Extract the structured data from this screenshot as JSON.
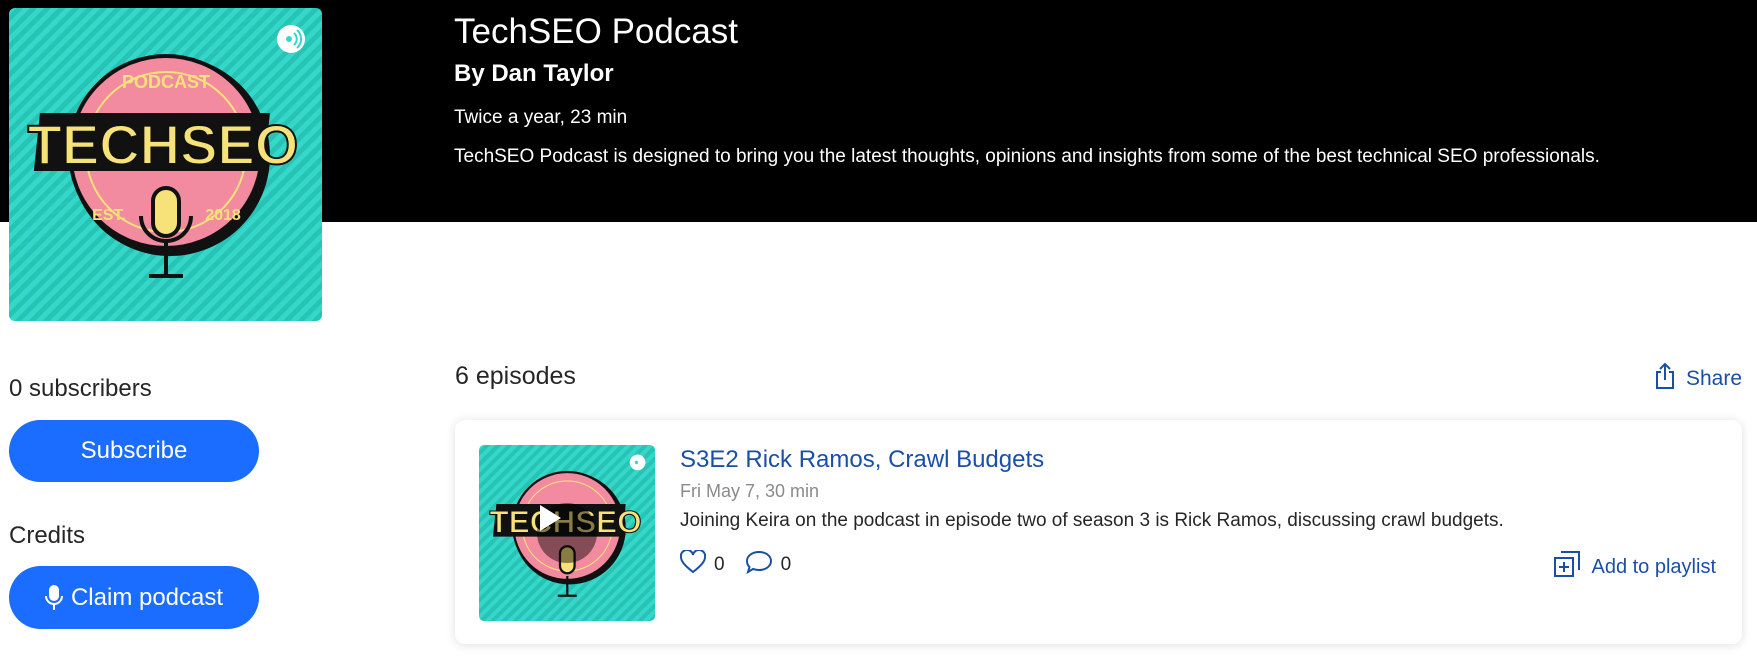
{
  "podcast": {
    "title": "TechSEO Podcast",
    "author": "By Dan Taylor",
    "frequency": "Twice a year, 23 min",
    "description": "TechSEO Podcast is designed to bring you the latest thoughts, opinions and insights from some of the best technical SEO professionals.",
    "cover_icon": "techseo-podcast-logo"
  },
  "cover_art": {
    "top_text": "PODCAST",
    "main_text": "TECHSEO",
    "bottom_left": "EST.",
    "bottom_right": "2018"
  },
  "sidebar": {
    "subscribers_label": "0 subscribers",
    "subscribe_label": "Subscribe",
    "credits_label": "Credits",
    "claim_label": "Claim podcast"
  },
  "episodes": {
    "count_label": "6 episodes",
    "share_label": "Share",
    "items": [
      {
        "title": "S3E2 Rick Ramos, Crawl Budgets",
        "meta": "Fri May 7, 30 min",
        "description": "Joining Keira on the podcast in episode two of season 3 is Rick Ramos, discussing crawl budgets.",
        "likes": "0",
        "comments": "0",
        "playlist_label": "Add to playlist"
      }
    ]
  },
  "colors": {
    "hero_bg": "#000000",
    "accent_blue": "#1a6dff",
    "link_blue": "#1a4fa8",
    "cover_teal": "#35d8c8",
    "cover_pink": "#f28aa0",
    "cover_yellow": "#f7e27a"
  }
}
